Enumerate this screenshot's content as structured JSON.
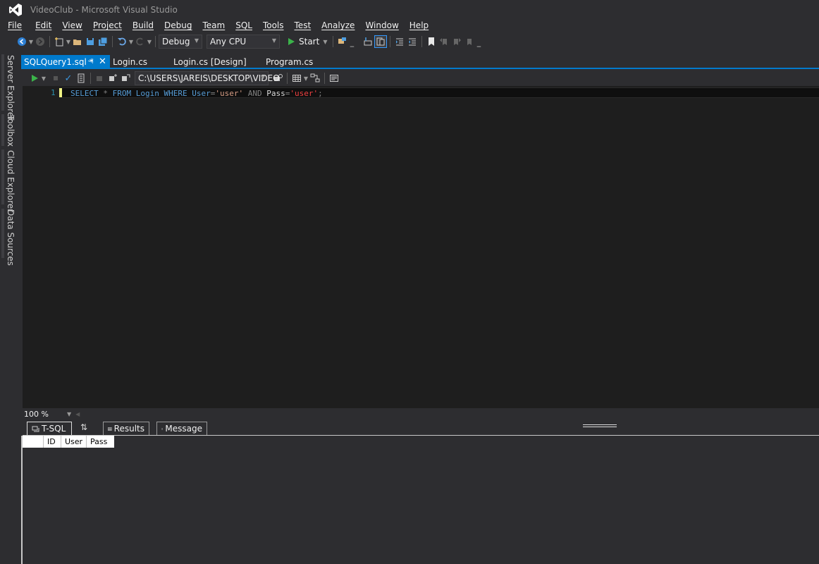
{
  "window": {
    "title": "VideoClub - Microsoft Visual Studio"
  },
  "menu": [
    "File",
    "Edit",
    "View",
    "Project",
    "Build",
    "Debug",
    "Team",
    "SQL",
    "Tools",
    "Test",
    "Analyze",
    "Window",
    "Help"
  ],
  "toolbar": {
    "config": "Debug",
    "platform": "Any CPU",
    "start_label": "Start"
  },
  "side_tabs": [
    "Server Explorer",
    "Toolbox",
    "Cloud Explorer",
    "Data Sources"
  ],
  "doc_tabs": [
    {
      "label": "SQLQuery1.sql *",
      "active": true
    },
    {
      "label": "Login.cs",
      "active": false
    },
    {
      "label": "Login.cs [Design]",
      "active": false
    },
    {
      "label": "Program.cs",
      "active": false
    }
  ],
  "sql_toolbar": {
    "connection": "C:\\USERS\\JAREIS\\DESKTOP\\VIDEO"
  },
  "editor": {
    "line_number": "1",
    "code": {
      "select": "SELECT",
      "star": "*",
      "from": "FROM",
      "table": "Login",
      "where": "WHERE",
      "col1": "User",
      "eq1": "=",
      "val1": "'user'",
      "and": "AND",
      "col2": "Pass",
      "eq2": "=",
      "val2": "'user'",
      "semi": ";"
    }
  },
  "zoom": {
    "value": "100 %"
  },
  "results_tabs": [
    "T-SQL",
    "Results",
    "Message"
  ],
  "results": {
    "columns": [
      "ID",
      "User",
      "Pass"
    ]
  },
  "colors": {
    "accent": "#007acc",
    "background": "#2d2d30",
    "editor": "#1e1e1e"
  }
}
